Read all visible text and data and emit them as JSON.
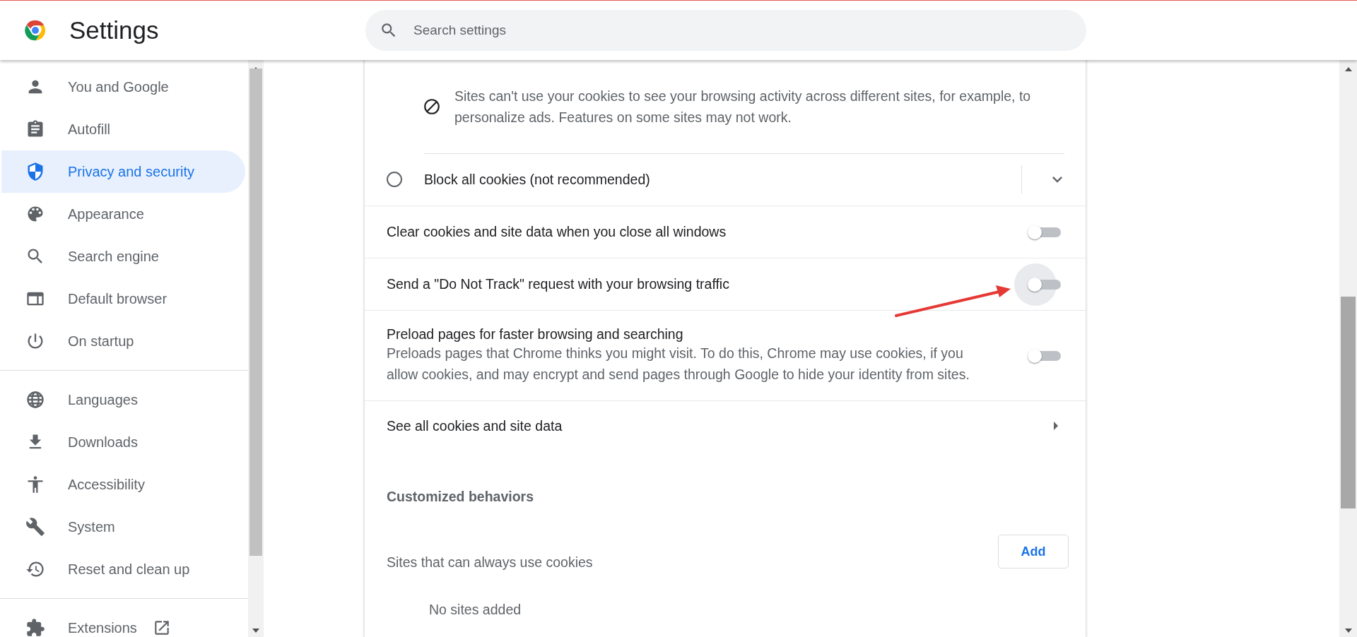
{
  "header": {
    "title": "Settings",
    "search": {
      "placeholder": "Search settings"
    }
  },
  "sidebar": {
    "groups": [
      {
        "items": [
          {
            "label": "You and Google",
            "selected": false
          },
          {
            "label": "Autofill",
            "selected": false
          },
          {
            "label": "Privacy and security",
            "selected": true
          },
          {
            "label": "Appearance",
            "selected": false
          },
          {
            "label": "Search engine",
            "selected": false
          },
          {
            "label": "Default browser",
            "selected": false
          },
          {
            "label": "On startup",
            "selected": false
          }
        ]
      },
      {
        "items": [
          {
            "label": "Languages",
            "selected": false
          },
          {
            "label": "Downloads",
            "selected": false
          },
          {
            "label": "Accessibility",
            "selected": false
          },
          {
            "label": "System",
            "selected": false
          },
          {
            "label": "Reset and clean up",
            "selected": false
          }
        ]
      },
      {
        "items": [
          {
            "label": "Extensions",
            "selected": false,
            "external": true
          }
        ]
      }
    ]
  },
  "card": {
    "block_description": "Sites can't use your cookies to see your browsing activity across different sites, for example, to personalize ads. Features on some sites may not work.",
    "block_all_cookies": {
      "label": "Block all cookies (not recommended)",
      "selected": false,
      "expanded": false
    },
    "toggles": [
      {
        "label": "Clear cookies and site data when you close all windows",
        "on": false,
        "focused": false
      },
      {
        "label": "Send a \"Do Not Track\" request with your browsing traffic",
        "on": false,
        "focused": true
      },
      {
        "label": "Preload pages for faster browsing and searching",
        "description": "Preloads pages that Chrome thinks you might visit. To do this, Chrome may use cookies, if you allow cookies, and may encrypt and send pages through Google to hide your identity from sites.",
        "on": false,
        "focused": false
      }
    ],
    "see_all": {
      "label": "See all cookies and site data"
    },
    "customized_behaviors": {
      "heading": "Customized behaviors",
      "allow_list": {
        "label": "Sites that can always use cookies",
        "button": "Add",
        "empty_text": "No sites added"
      }
    },
    "pointer_arrow": true
  }
}
